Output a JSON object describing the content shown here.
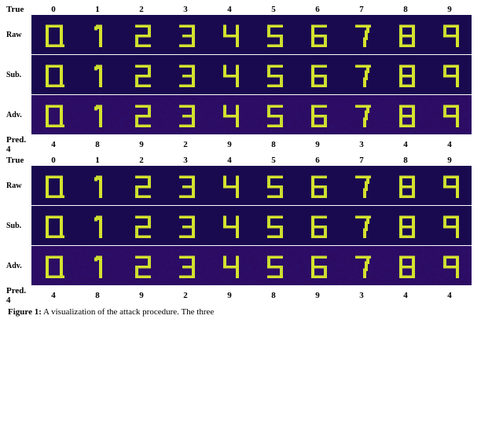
{
  "sections": [
    {
      "true_row_label": "True",
      "true_vals": [
        "0",
        "1",
        "2",
        "3",
        "4",
        "5",
        "6",
        "7",
        "8",
        "9"
      ],
      "rows": [
        {
          "label": "Raw",
          "type": "raw",
          "section": 0
        },
        {
          "label": "Sub.",
          "type": "sub",
          "section": 0
        },
        {
          "label": "Adv.",
          "type": "adv",
          "section": 0
        }
      ],
      "pred_label": "Pred. 4",
      "pred_vals": [
        "4",
        "8",
        "9",
        "2",
        "9",
        "8",
        "9",
        "3",
        "4",
        "4"
      ]
    },
    {
      "true_row_label": "True",
      "true_vals": [
        "0",
        "1",
        "2",
        "3",
        "4",
        "5",
        "6",
        "7",
        "8",
        "9"
      ],
      "rows": [
        {
          "label": "Raw",
          "type": "raw",
          "section": 1
        },
        {
          "label": "Sub.",
          "type": "sub",
          "section": 1
        },
        {
          "label": "Adv.",
          "type": "adv",
          "section": 1
        }
      ],
      "pred_label": "Pred. 4",
      "pred_vals": [
        "4",
        "8",
        "9",
        "2",
        "9",
        "8",
        "9",
        "3",
        "4",
        "4"
      ]
    }
  ],
  "caption": "Figure 1: A visualization of the attack procedure. The three"
}
